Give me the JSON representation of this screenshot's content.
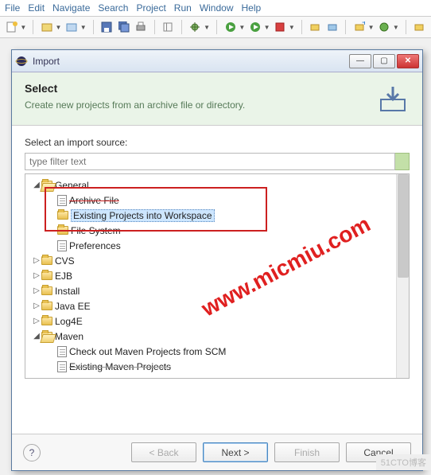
{
  "menubar": [
    "File",
    "Edit",
    "Navigate",
    "Search",
    "Project",
    "Run",
    "Window",
    "Help"
  ],
  "dialog": {
    "title": "Import",
    "banner_title": "Select",
    "banner_desc": "Create new projects from an archive file or directory.",
    "source_label": "Select an import source:",
    "filter_placeholder": "type filter text"
  },
  "tree": {
    "general": "General",
    "archive": "Archive File",
    "existing": "Existing Projects into Workspace",
    "filesystem": "File System",
    "prefs": "Preferences",
    "cvs": "CVS",
    "ejb": "EJB",
    "install": "Install",
    "javaee": "Java EE",
    "log4e": "Log4E",
    "maven": "Maven",
    "maven1": "Check out Maven Projects from SCM",
    "maven2": "Existing Maven Projects"
  },
  "buttons": {
    "back": "< Back",
    "next": "Next >",
    "finish": "Finish",
    "cancel": "Cancel"
  },
  "watermark": "www.micmiu.com",
  "sidetag": "51CTO博客"
}
